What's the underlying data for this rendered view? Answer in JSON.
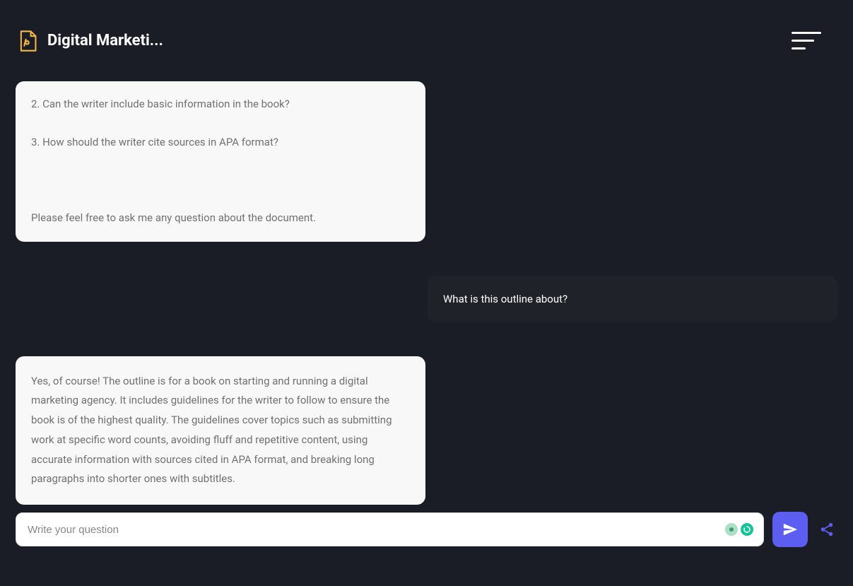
{
  "header": {
    "title": "Digital Marketi..."
  },
  "messages": {
    "assistant1": {
      "q2": "2. Can the writer include basic information in the book?",
      "q3": "3. How should the writer cite sources in APA format?",
      "footer": "Please feel free to ask me any question about the document."
    },
    "user1": "What is this outline about?",
    "assistant2": "Yes, of course! The outline is for a book on starting and running a digital marketing agency. It includes guidelines for the writer to follow to ensure the book is of the highest quality. The guidelines cover topics such as submitting work at specific word counts, avoiding fluff and repetitive content, using accurate information with sources cited in APA format, and breaking long paragraphs into shorter ones with subtitles."
  },
  "input": {
    "placeholder": "Write your question"
  }
}
